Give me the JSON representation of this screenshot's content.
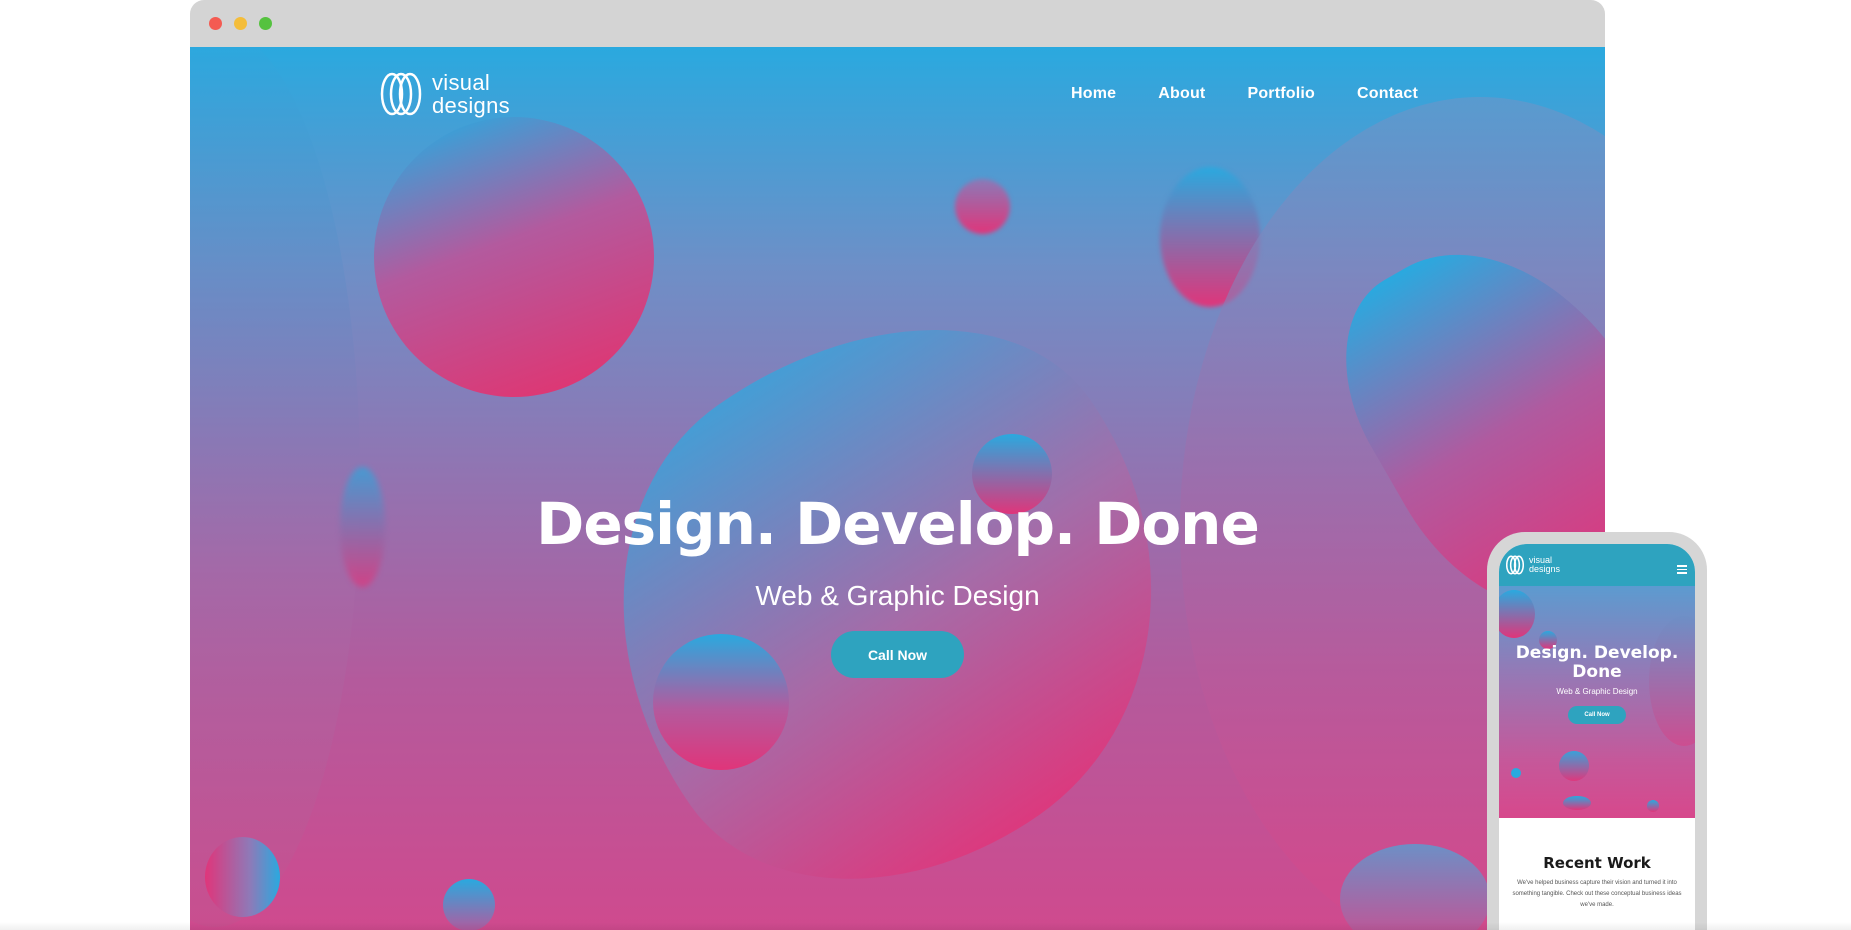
{
  "colors": {
    "accent": "#2ea3bf",
    "gradient_top": "#2aa9df",
    "gradient_mid": "#9472b0",
    "gradient_bottom": "#cf4a8e",
    "blob_pink": "#e0357a",
    "blob_blue": "#2aa9df"
  },
  "desktop": {
    "logo": {
      "icon": "overlapping-circles-logo-icon",
      "line1": "visual",
      "line2": "designs"
    },
    "nav": [
      {
        "label": "Home"
      },
      {
        "label": "About"
      },
      {
        "label": "Portfolio"
      },
      {
        "label": "Contact"
      }
    ],
    "hero": {
      "title": "Design. Develop. Done",
      "subtitle": "Web & Graphic Design",
      "cta_label": "Call Now"
    }
  },
  "mobile": {
    "logo": {
      "icon": "overlapping-circles-logo-icon",
      "line1": "visual",
      "line2": "designs"
    },
    "menu_icon": "hamburger-menu-icon",
    "hero": {
      "title_line1": "Design. Develop.",
      "title_line2": "Done",
      "subtitle": "Web & Graphic Design",
      "cta_label": "Call Now"
    },
    "recent": {
      "title": "Recent Work",
      "text": "We've helped business capture their vision and turned it into something tangible. Check out these conceptual business ideas we've made."
    }
  }
}
